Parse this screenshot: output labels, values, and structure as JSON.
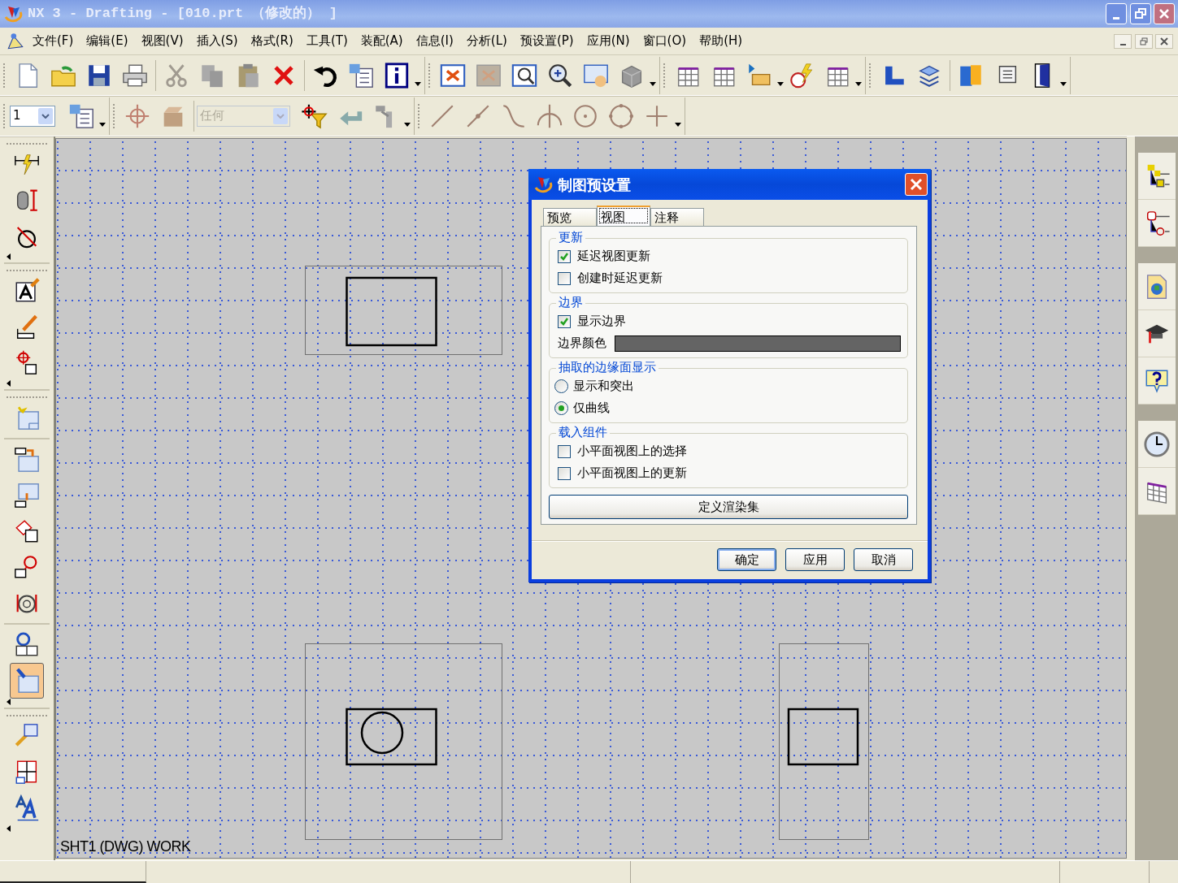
{
  "window": {
    "title": "NX 3 - Drafting - [010.prt （修改的） ]"
  },
  "menu": [
    {
      "label": "文件(F)"
    },
    {
      "label": "编辑(E)"
    },
    {
      "label": "视图(V)"
    },
    {
      "label": "插入(S)"
    },
    {
      "label": "格式(R)"
    },
    {
      "label": "工具(T)"
    },
    {
      "label": "装配(A)"
    },
    {
      "label": "信息(I)"
    },
    {
      "label": "分析(L)"
    },
    {
      "label": "预设置(P)"
    },
    {
      "label": "应用(N)"
    },
    {
      "label": "窗口(O)"
    },
    {
      "label": "帮助(H)"
    }
  ],
  "toolbar": {
    "layer_combo": {
      "value": "1",
      "disabled": false
    },
    "filter_combo": {
      "value": "任何",
      "disabled": true
    }
  },
  "left_toolbar": {
    "tools": [
      {
        "selected": false
      },
      {
        "selected": false
      },
      {
        "selected": false
      },
      {
        "selected": false
      },
      {
        "selected": false
      },
      {
        "selected": false
      },
      {
        "selected": false
      },
      {
        "selected": false
      },
      {
        "selected": false
      },
      {
        "selected": false
      },
      {
        "selected": false
      },
      {
        "selected": false
      },
      {
        "selected": false
      },
      {
        "selected": true
      },
      {
        "selected": false
      },
      {
        "selected": false
      },
      {
        "selected": false
      }
    ]
  },
  "canvas": {
    "sheet_label": "SHT1 (DWG) WORK"
  },
  "dialog": {
    "title": "制图预设置",
    "tabs": [
      {
        "label": "预览",
        "selected": false
      },
      {
        "label": "视图",
        "selected": true
      },
      {
        "label": "注释",
        "selected": false
      }
    ],
    "groups": [
      {
        "title": "更新",
        "items": [
          {
            "kind": "checkbox",
            "label": "延迟视图更新",
            "checked": true
          },
          {
            "kind": "checkbox",
            "label": "创建时延迟更新",
            "checked": false
          }
        ]
      },
      {
        "title": "边界",
        "items": [
          {
            "kind": "checkbox",
            "label": "显示边界",
            "checked": true
          },
          {
            "kind": "color",
            "label": "边界颜色",
            "color": "#646464"
          }
        ]
      },
      {
        "title": "抽取的边缘面显示",
        "items": [
          {
            "kind": "radio",
            "label": "显示和突出",
            "selected": false
          },
          {
            "kind": "radio",
            "label": "仅曲线",
            "selected": true
          }
        ]
      },
      {
        "title": "载入组件",
        "items": [
          {
            "kind": "checkbox",
            "label": "小平面视图上的选择",
            "checked": false
          },
          {
            "kind": "checkbox",
            "label": "小平面视图上的更新",
            "checked": false
          }
        ]
      }
    ],
    "wide_button": "定义渲染集",
    "buttons": [
      {
        "label": "确定",
        "default": true
      },
      {
        "label": "应用",
        "default": false
      },
      {
        "label": "取消",
        "default": false
      }
    ]
  }
}
